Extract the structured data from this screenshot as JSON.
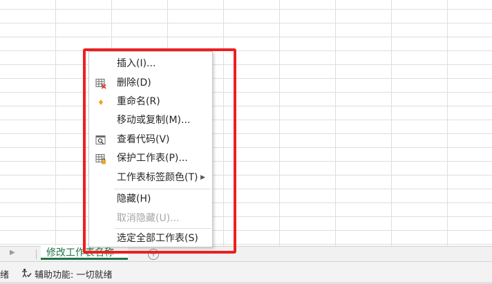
{
  "sheet_tabs": [
    {
      "label": "修改工作表名称",
      "active": true
    }
  ],
  "tabbar": {
    "nav_arrow": "▶",
    "add_sheet_symbol": "+"
  },
  "status_bar": {
    "ready_fragment": "绪",
    "accessibility_icon": "accessibility-check-icon",
    "accessibility_text": "辅助功能: 一切就绪"
  },
  "context_menu": {
    "items": [
      {
        "label": "插入(I)...",
        "icon": null,
        "enabled": true
      },
      {
        "label": "删除(D)",
        "icon": "delete-sheet-icon",
        "enabled": true
      },
      {
        "label": "重命名(R)",
        "icon": "rename-icon",
        "enabled": true
      },
      {
        "label": "移动或复制(M)...",
        "icon": null,
        "enabled": true
      },
      {
        "label": "查看代码(V)",
        "icon": "view-code-icon",
        "enabled": true
      },
      {
        "label": "保护工作表(P)...",
        "icon": "protect-sheet-icon",
        "enabled": true
      },
      {
        "label": "工作表标签颜色(T)",
        "icon": null,
        "enabled": true,
        "submenu": true
      },
      {
        "label": "隐藏(H)",
        "icon": null,
        "enabled": true
      },
      {
        "label": "取消隐藏(U)...",
        "icon": null,
        "enabled": false
      },
      {
        "label": "选定全部工作表(S)",
        "icon": null,
        "enabled": true
      }
    ]
  },
  "colors": {
    "highlight": "#ec1f1f",
    "sheet_tab_accent": "#217346",
    "rename_icon": "#f0a020"
  }
}
